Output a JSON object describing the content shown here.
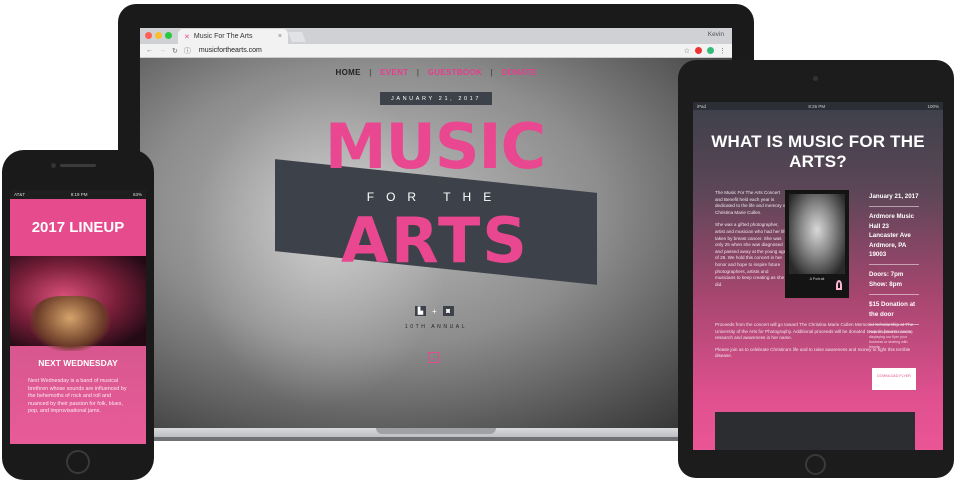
{
  "laptop": {
    "browser": {
      "tab_title": "Music For The Arts",
      "profile": "Kevin",
      "url": "musicforthearts.com",
      "colors": {
        "close": "#ff5f57",
        "min": "#febc2e",
        "max": "#28c840"
      }
    },
    "site": {
      "nav": {
        "home": "HOME",
        "event": "EVENT",
        "guestbook": "GUESTBOOK",
        "donate": "DONATE",
        "separator": "|"
      },
      "date": "JANUARY 21, 2017",
      "logo": {
        "line1": "MUSIC",
        "line2": "FOR THE",
        "line3": "ARTS"
      },
      "sponsor_plus": "+",
      "annual": "10TH ANNUAL",
      "accent": "#e9478f"
    }
  },
  "tablet": {
    "status_left": "iPad",
    "status_center": "8:26 PM",
    "status_right": "100%",
    "title": "WHAT IS MUSIC FOR THE ARTS?",
    "paragraphs": [
      "The Music For The Arts Concert and Benefit held each year is dedicated to the life and memory of Christina Marie Cullen.",
      "She was a gifted photographer, artist and musician who had her life taken by breast cancer. She was only 25 when she was diagnosed and passed away at the young age of 28. We hold this concert in her honor and hope to inspire future photographers, artists and musicians to keep creating as she did."
    ],
    "full_paragraphs": [
      "Proceeds from the concert will go toward The Christina Marie Cullen Memorial Scholarship at The University of the Arts for Photography. Additional proceeds will be donated towards breast cancer research and awareness in her name.",
      "Please join us to celebrate Christina's life and to raise awareness and money to fight this terrible disease."
    ],
    "photo_caption": "A Portrait",
    "sidebar": {
      "date": "January 21, 2017",
      "venue": "Ardmore Music Hall 23 Lancaster Ave Ardmore, PA 19003",
      "doors": "Doors: 7pm",
      "show": "Show: 8pm",
      "donation": "$15 Donation at the door",
      "note": "Help us spread the word by displaying our flyer your business or sharing with friends.",
      "flyer_button": "DOWNLOAD FLYER"
    }
  },
  "phone": {
    "status_left": "AT&T",
    "status_center": "8:19 PM",
    "status_right": "63%",
    "lineup_title": "2017 LINEUP",
    "section_title": "NEXT WEDNESDAY",
    "section_text": "Next Wednesday is a band of musical brethren whose sounds are influenced by the behemoths of rock and roll and nuanced by their passion for folk, blues, pop, and improvisational jams."
  }
}
